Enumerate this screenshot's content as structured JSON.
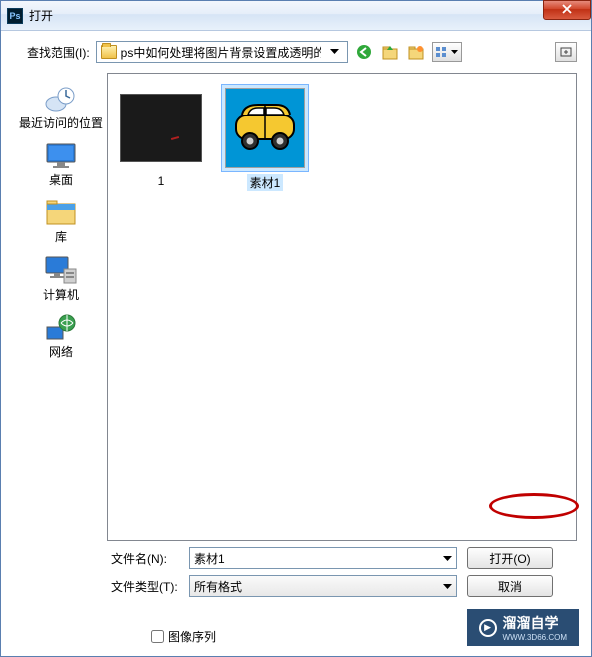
{
  "window": {
    "title": "打开"
  },
  "lookin": {
    "label": "查找范围(I):",
    "value": "ps中如何处理将图片背景设置成透明的"
  },
  "places": {
    "recent": "最近访问的位置",
    "desktop": "桌面",
    "libraries": "库",
    "computer": "计算机",
    "network": "网络"
  },
  "files": {
    "file1_label": "1",
    "file2_label": "素材1"
  },
  "form": {
    "filename_label": "文件名(N):",
    "filename_value": "素材1",
    "filetype_label": "文件类型(T):",
    "filetype_value": "所有格式",
    "image_sequence": "图像序列"
  },
  "buttons": {
    "open": "打开(O)",
    "cancel": "取消",
    "close": "X"
  },
  "watermark": {
    "text": "溜溜自学",
    "url": "WWW.3D66.COM"
  }
}
